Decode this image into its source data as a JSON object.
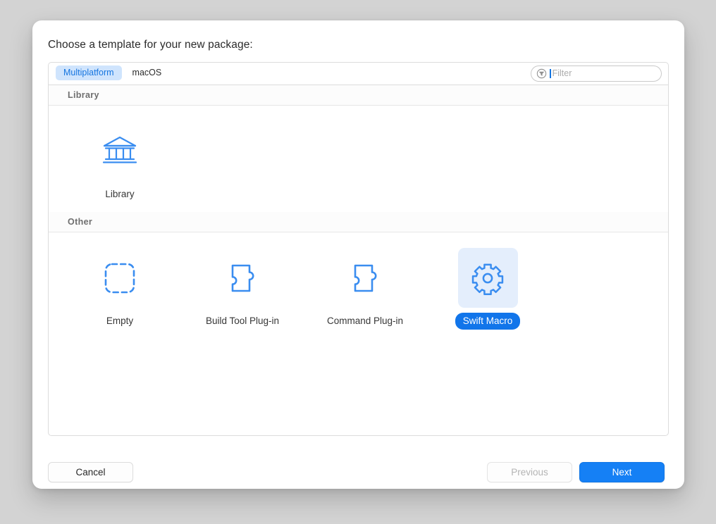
{
  "dialog": {
    "prompt": "Choose a template for your new package:"
  },
  "toolbar": {
    "tabs": [
      {
        "label": "Multiplatform",
        "selected": true
      },
      {
        "label": "macOS",
        "selected": false
      }
    ],
    "filter": {
      "icon": "filter-icon",
      "value": "",
      "placeholder": "Filter"
    }
  },
  "sections": [
    {
      "header": "Library",
      "tiles": [
        {
          "label": "Library",
          "icon": "library-building-icon",
          "selected": false
        }
      ]
    },
    {
      "header": "Other",
      "tiles": [
        {
          "label": "Empty",
          "icon": "dashed-square-icon",
          "selected": false
        },
        {
          "label": "Build Tool Plug-in",
          "icon": "puzzle-piece-icon",
          "selected": false
        },
        {
          "label": "Command Plug-in",
          "icon": "puzzle-piece-icon",
          "selected": false
        },
        {
          "label": "Swift Macro",
          "icon": "gear-icon",
          "selected": true
        }
      ]
    }
  ],
  "footer": {
    "cancel_label": "Cancel",
    "previous_label": "Previous",
    "next_label": "Next"
  },
  "colors": {
    "accent_blue": "#1175ea",
    "icon_blue": "#3a8df0",
    "tab_selected_bg": "#cfe4fd",
    "tab_selected_text": "#1575e0",
    "selected_tile_bg": "#e4eefc",
    "backdrop": "#d3d3d3"
  }
}
